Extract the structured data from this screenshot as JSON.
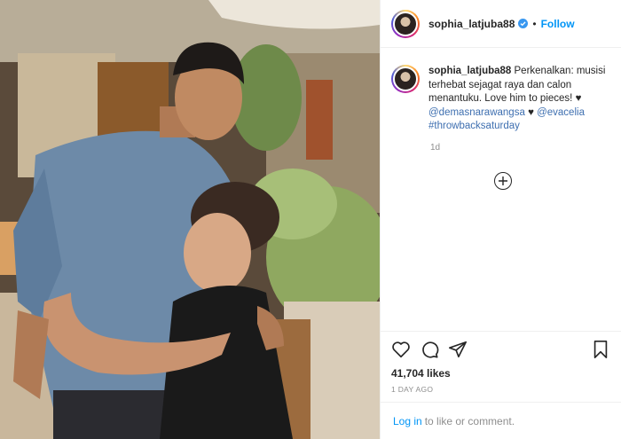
{
  "post": {
    "username": "sophia_latjuba88",
    "separator": "•",
    "follow_label": "Follow"
  },
  "caption": {
    "username": "sophia_latjuba88",
    "text": "Perkenalkan: musisi terhebat sejagat raya dan calon menantuku. Love him to pieces! ♥",
    "mention1": "@demasnarawangsa",
    "heart": "♥",
    "mention2": "@evacelia",
    "hashtag": "#throwbacksaturday",
    "time_ago": "1d"
  },
  "actions": {
    "likes": "41,704 likes",
    "date": "1 DAY AGO"
  },
  "footer": {
    "login_label": "Log in",
    "rest": "to like or comment."
  },
  "icons": [
    "heart-icon",
    "comment-icon",
    "share-icon",
    "bookmark-icon",
    "load-more-icon",
    "verified-icon"
  ],
  "colors": {
    "link_blue": "#0095f6",
    "mention": "#00376b",
    "muted": "#8e8e8e",
    "text": "#262626"
  }
}
